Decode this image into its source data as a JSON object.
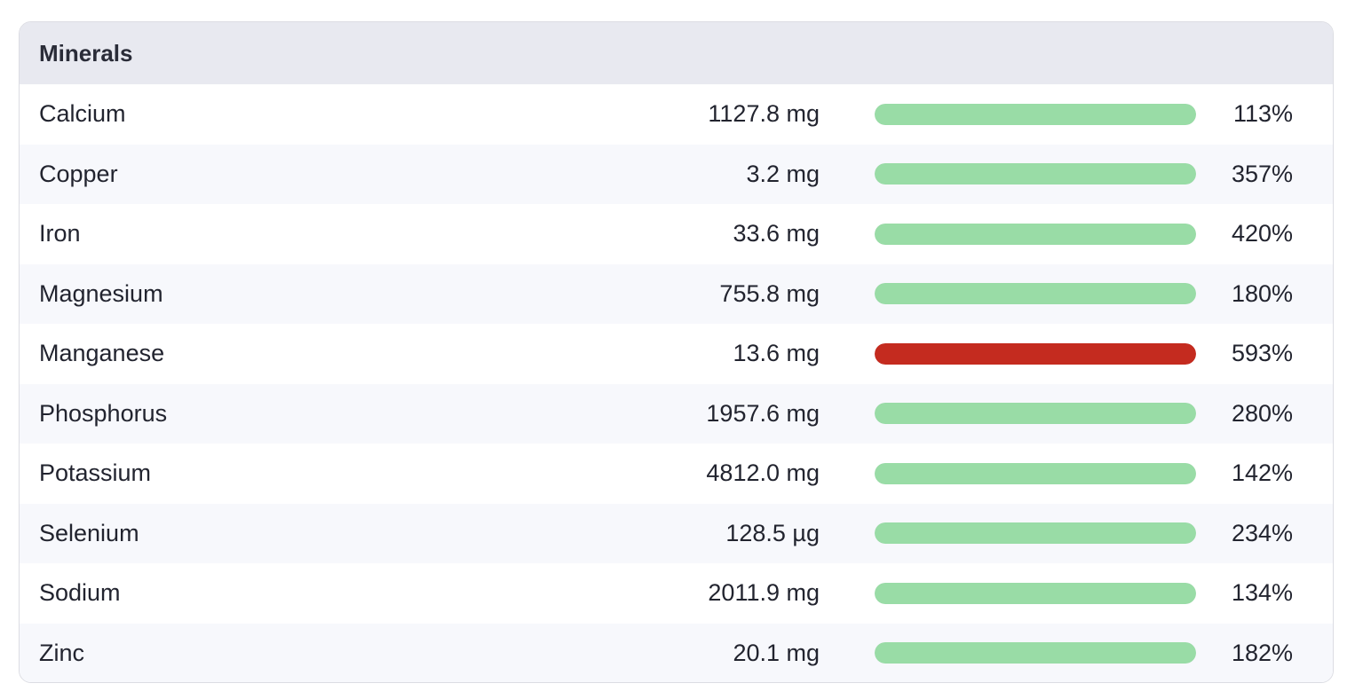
{
  "panel": {
    "title": "Minerals"
  },
  "colors": {
    "normal": "#99dca6",
    "excess": "#c42b1f"
  },
  "rows": [
    {
      "name": "Calcium",
      "amount": "1127.8 mg",
      "percent": "113%",
      "percent_value": 113,
      "status": "normal"
    },
    {
      "name": "Copper",
      "amount": "3.2 mg",
      "percent": "357%",
      "percent_value": 357,
      "status": "normal"
    },
    {
      "name": "Iron",
      "amount": "33.6 mg",
      "percent": "420%",
      "percent_value": 420,
      "status": "normal"
    },
    {
      "name": "Magnesium",
      "amount": "755.8 mg",
      "percent": "180%",
      "percent_value": 180,
      "status": "normal"
    },
    {
      "name": "Manganese",
      "amount": "13.6 mg",
      "percent": "593%",
      "percent_value": 593,
      "status": "excess"
    },
    {
      "name": "Phosphorus",
      "amount": "1957.6 mg",
      "percent": "280%",
      "percent_value": 280,
      "status": "normal"
    },
    {
      "name": "Potassium",
      "amount": "4812.0 mg",
      "percent": "142%",
      "percent_value": 142,
      "status": "normal"
    },
    {
      "name": "Selenium",
      "amount": "128.5 µg",
      "percent": "234%",
      "percent_value": 234,
      "status": "normal"
    },
    {
      "name": "Sodium",
      "amount": "2011.9 mg",
      "percent": "134%",
      "percent_value": 134,
      "status": "normal"
    },
    {
      "name": "Zinc",
      "amount": "20.1 mg",
      "percent": "182%",
      "percent_value": 182,
      "status": "normal"
    }
  ]
}
